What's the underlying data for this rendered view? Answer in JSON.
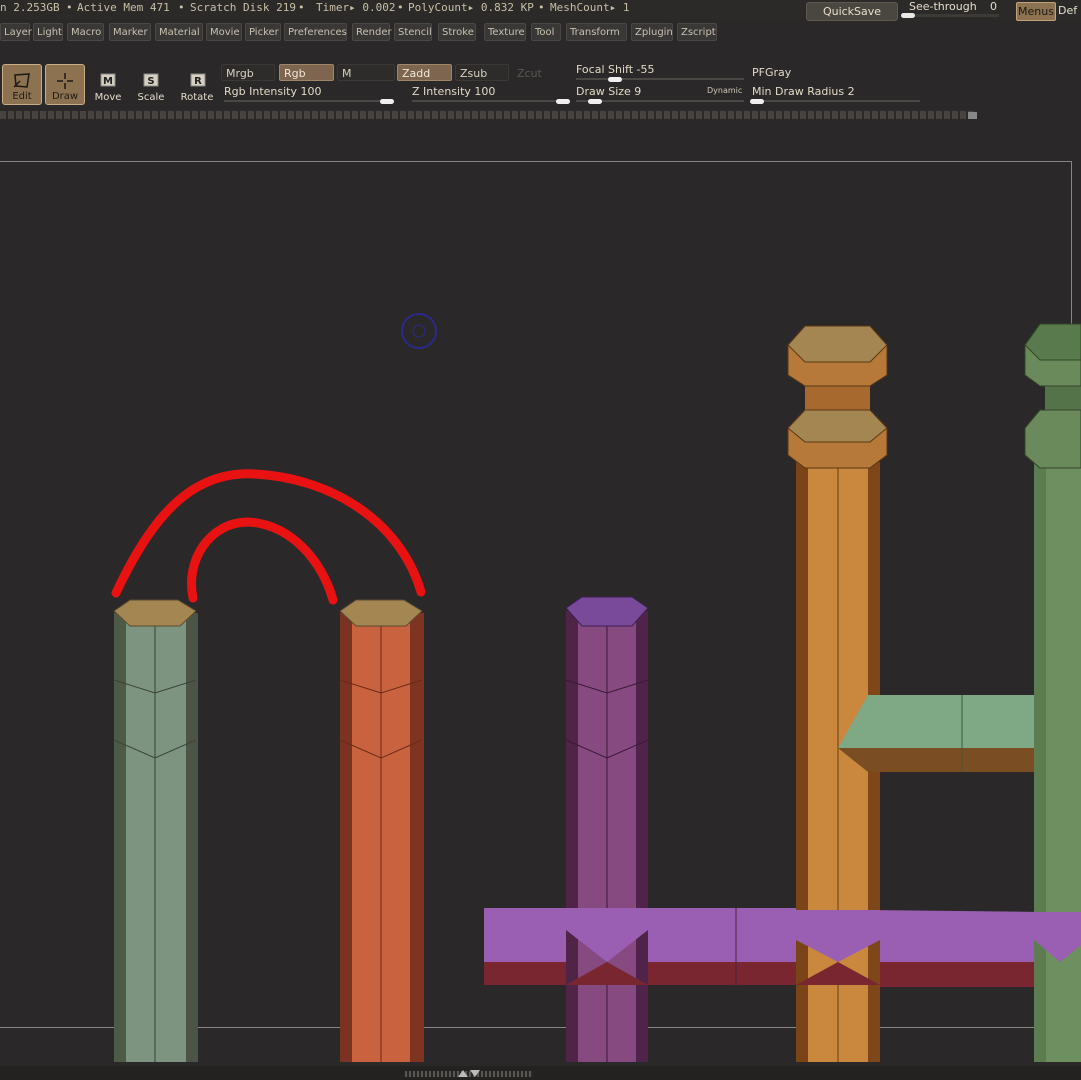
{
  "status": {
    "mem": "n 2.253GB",
    "active_mem": "Active Mem 471",
    "scratch": "Scratch Disk 219",
    "timer": "Timer▸ 0.002",
    "polycount": "PolyCount▸ 0.832 KP",
    "meshcount": "MeshCount▸ 1",
    "quicksave": "QuickSave",
    "see_through_label": "See-through",
    "see_through_value": "0",
    "menus": "Menus",
    "default": "Def"
  },
  "menu": [
    "Layer",
    "Light",
    "Macro",
    "Marker",
    "Material",
    "Movie",
    "Picker",
    "Preferences",
    "Render",
    "Stencil",
    "Stroke",
    "Texture",
    "Tool",
    "Transform",
    "Zplugin",
    "Zscript"
  ],
  "tools": {
    "edit": "Edit",
    "draw": "Draw",
    "move": "Move",
    "scale": "Scale",
    "rotate": "Rotate"
  },
  "modes": {
    "mrgb": "Mrgb",
    "rgb": "Rgb",
    "m": "M",
    "zadd": "Zadd",
    "zsub": "Zsub",
    "zcut": "Zcut"
  },
  "sliders": {
    "rgb_intensity": "Rgb  Intensity 100",
    "z_intensity": "Z  Intensity 100",
    "focal_shift": "Focal  Shift -55",
    "draw_size": "Draw  Size 9",
    "dynamic": "Dynamic",
    "material": "PFGray",
    "min_draw_radius": "Min  Draw  Radius 2"
  },
  "colors": {
    "accent": "#8c7250",
    "curve": "#e81212",
    "pillar_green": "#6f8a73",
    "pillar_orange": "#c75e3e",
    "pillar_purple": "#7a3f6e",
    "beam_purple": "#9a5fb3",
    "column_orange": "#c27a35",
    "column_green": "#6b8a5c",
    "cap_tan": "#9a804f"
  }
}
